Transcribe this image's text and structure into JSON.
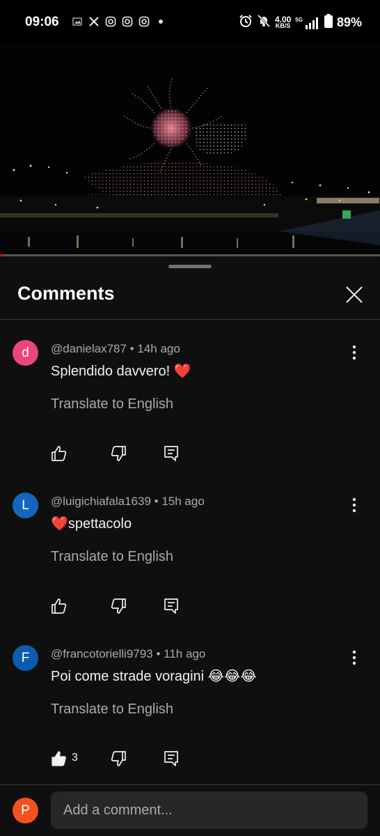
{
  "status_bar": {
    "time": "09:06",
    "speed_value": "4.00",
    "speed_unit": "KB/S",
    "network": "5G",
    "battery": "89%",
    "left_icons": [
      "gallery-icon",
      "x-icon",
      "instagram-icon",
      "instagram-icon",
      "instagram-icon",
      "dot-icon"
    ],
    "right_icons": [
      "alarm-icon",
      "mute-icon",
      "data-speed",
      "signal-icon",
      "battery-icon"
    ]
  },
  "video": {
    "progress_fraction": 0.01
  },
  "sheet": {
    "title": "Comments",
    "close_icon": "close-icon"
  },
  "comments": [
    {
      "avatar_letter": "d",
      "avatar_color": "#e8467c",
      "author": "@danielax787",
      "time": "14h ago",
      "text": "Splendido davvero! ❤️",
      "translate": "Translate to English",
      "like_count": ""
    },
    {
      "avatar_letter": "L",
      "avatar_color": "#1565c0",
      "author": "@luigichiafala1639",
      "time": "15h ago",
      "text": "❤️spettacolo",
      "translate": "Translate to English",
      "like_count": ""
    },
    {
      "avatar_letter": "F",
      "avatar_color": "#0b5cad",
      "author": "@francotorielli9793",
      "time": "11h ago",
      "text": "Poi come strade voragini 😂😂😂",
      "translate": "Translate to English",
      "like_count": "3"
    }
  ],
  "add_comment": {
    "avatar_letter": "P",
    "avatar_color": "#f4511e",
    "placeholder": "Add a comment..."
  }
}
